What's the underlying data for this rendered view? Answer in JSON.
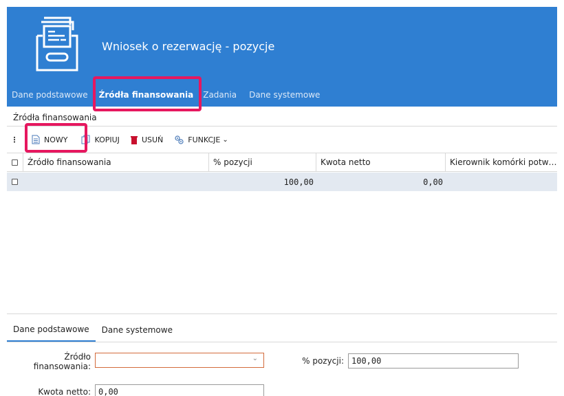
{
  "header": {
    "title": "Wniosek o rezerwację - pozycje",
    "icon": "file-cabinet-icon",
    "bg_color": "#2f7fd2"
  },
  "tabs": [
    {
      "label": "Dane podstawowe"
    },
    {
      "label": "Źródła finansowania"
    },
    {
      "label": "Zadania"
    },
    {
      "label": "Dane systemowe"
    }
  ],
  "section": {
    "title": "Źródła finansowania"
  },
  "toolbar": {
    "menu_glyph": "⋮",
    "new_label": "NOWY",
    "copy_label": "KOPIUJ",
    "delete_label": "USUŃ",
    "functions_label": "FUNKCJE",
    "functions_chevron": "⌄"
  },
  "grid": {
    "columns": [
      "Źródło finansowania",
      "% pozycji",
      "Kwota netto",
      "Kierownik komórki potw…"
    ],
    "rows": [
      {
        "zrodlo": "",
        "procent": "100,00",
        "kwota": "0,00",
        "kierownik": ""
      }
    ]
  },
  "bottom_tabs": [
    {
      "label": "Dane podstawowe"
    },
    {
      "label": "Dane systemowe"
    }
  ],
  "form": {
    "zrodlo_label_line1": "Źródło",
    "zrodlo_label_line2": "finansowania:",
    "zrodlo_value": "",
    "procent_label": "% pozycji:",
    "procent_value": "100,00",
    "kwota_label": "Kwota netto:",
    "kwota_value": "0,00"
  },
  "colors": {
    "accent": "#2f7fd2",
    "highlight": "#e6175f",
    "row_bg": "#e3e9f1",
    "delete_icon": "#c8102e"
  }
}
